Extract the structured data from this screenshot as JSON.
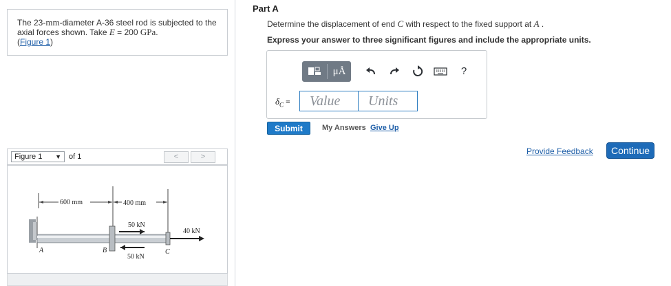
{
  "problem": {
    "text_1": "The 23-",
    "mm": "mm",
    "text_2": "-diameter A-36 steel rod is subjected to the axial forces shown. Take ",
    "E": "E",
    "eq": " = 200 ",
    "gpa": "GPa",
    "period": ".",
    "figure_link": "Figure 1"
  },
  "figure_bar": {
    "select_value": "Figure 1",
    "of_label": "of 1",
    "prev_label": "<",
    "next_label": ">"
  },
  "figure": {
    "dim_left": "600 mm",
    "dim_right": "400 mm",
    "force_top": "50 kN",
    "force_bottom": "50 kN",
    "force_end": "40 kN",
    "label_A": "A",
    "label_B": "B",
    "label_C": "C"
  },
  "part": {
    "title": "Part A",
    "question_1": "Determine the displacement of end ",
    "C": "C",
    "question_2": " with respect to the fixed support at ",
    "A": "A",
    "question_3": " .",
    "instruction": "Express your answer to three significant figures and include the appropriate units."
  },
  "toolbar": {
    "templates_icon": "templates-icon",
    "units_label": "μÅ",
    "undo_icon": "undo-icon",
    "redo_icon": "redo-icon",
    "reset_icon": "reset-icon",
    "keyboard_icon": "keyboard-icon",
    "help_label": "?"
  },
  "answer": {
    "variable": "δ",
    "subscript": "C",
    "equals": " =",
    "value_placeholder": "Value",
    "units_placeholder": "Units"
  },
  "actions": {
    "submit": "Submit",
    "my_answers": "My Answers",
    "give_up": "Give Up",
    "feedback": "Provide Feedback",
    "continue": "Continue"
  },
  "colors": {
    "link": "#1f5fa8",
    "primary_button": "#1e7ac8",
    "toolbar": "#707a85"
  }
}
